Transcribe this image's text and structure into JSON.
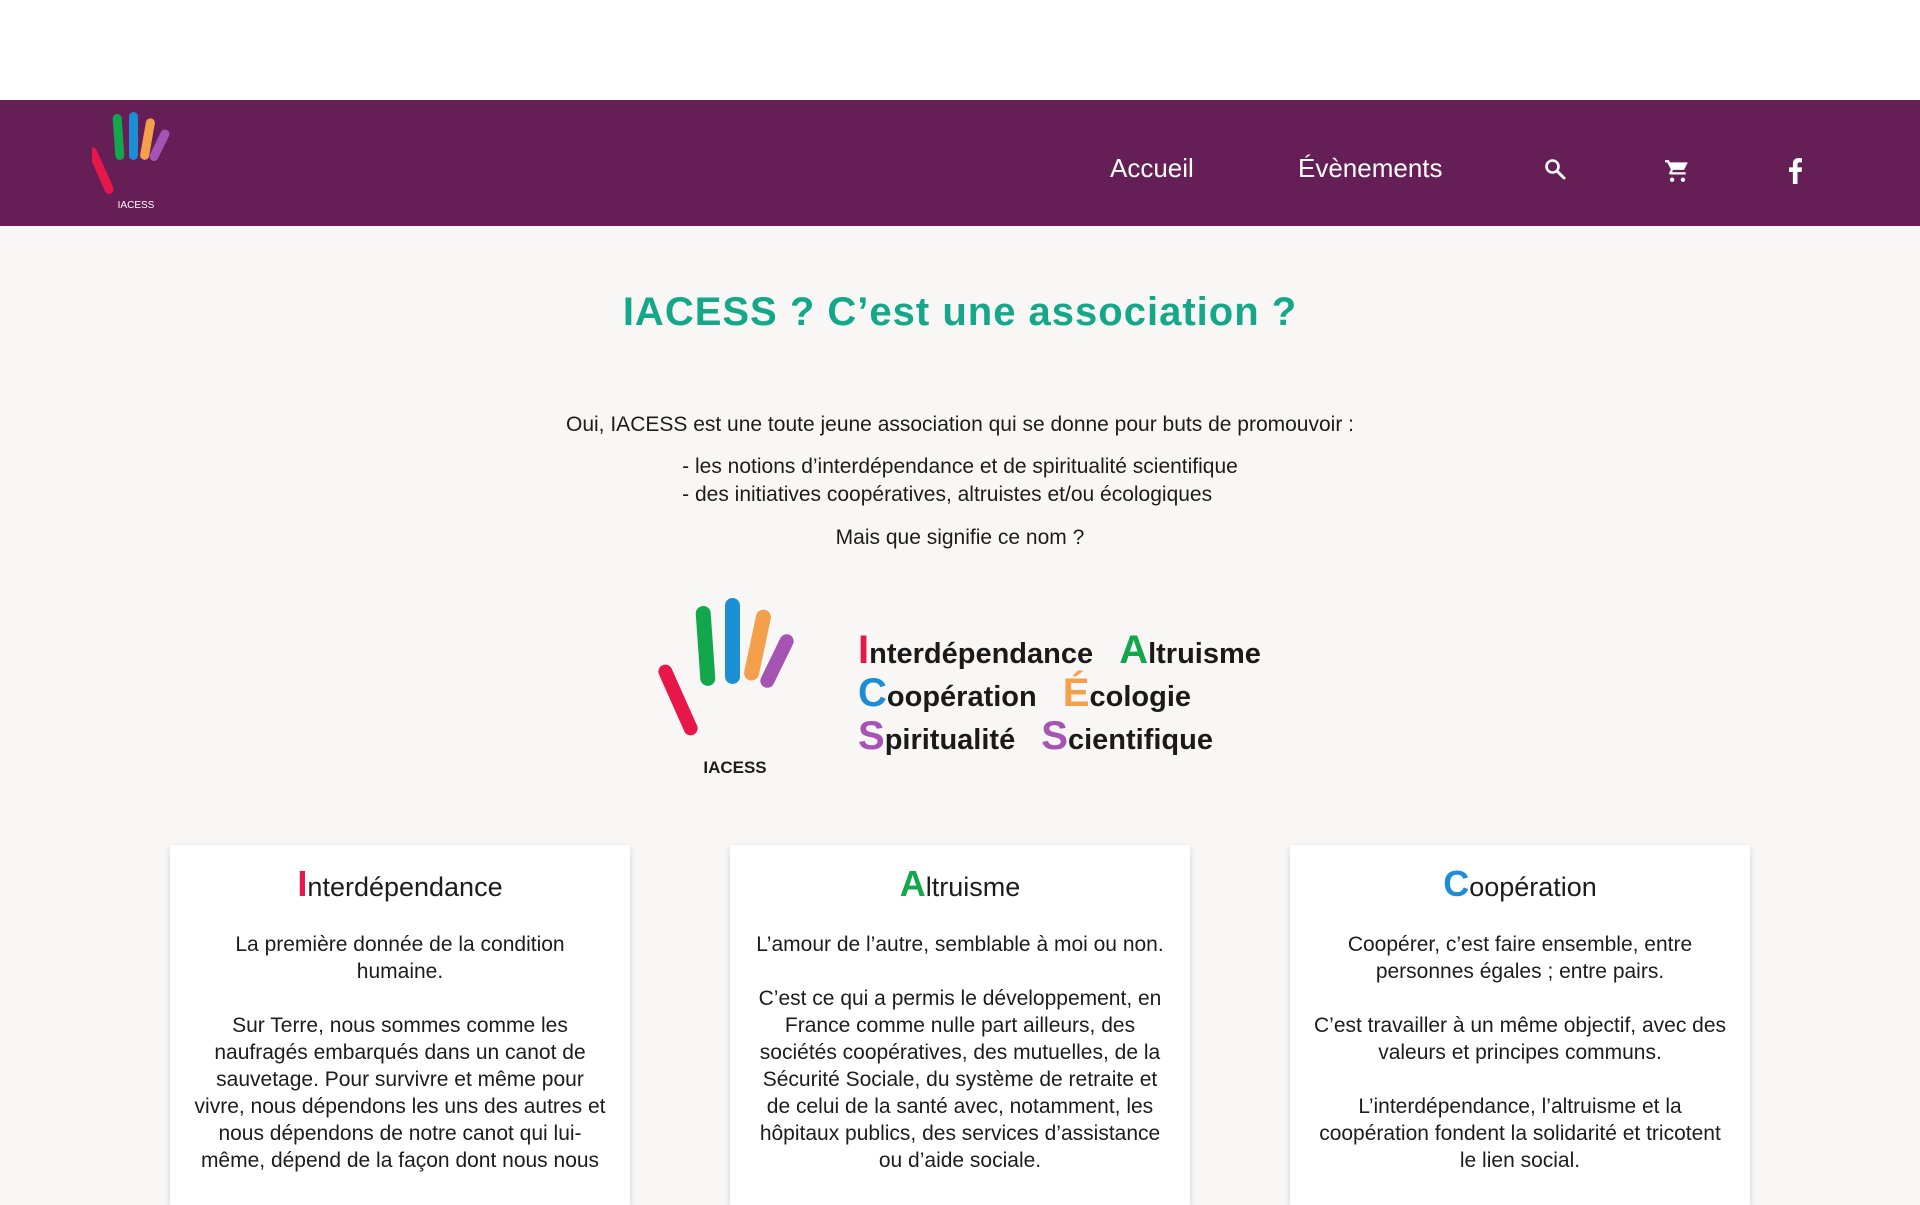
{
  "brand": {
    "logo_text": "IACESS",
    "colors": {
      "purple_header": "#661e57",
      "title_green": "#14a888",
      "red": "#e8174a",
      "green": "#12a74b",
      "blue": "#1c8ed4",
      "orange": "#f4a04a",
      "violet": "#a554b3"
    }
  },
  "nav": {
    "items": [
      {
        "label": "Accueil"
      },
      {
        "label": "Évènements"
      }
    ],
    "icons": [
      "search-icon",
      "cart-icon",
      "facebook-icon"
    ]
  },
  "main": {
    "title": "IACESS ? C’est une association ?",
    "intro": "Oui, IACESS est une toute jeune association qui se donne pour buts de promouvoir :",
    "list": [
      "- les notions d’interdépendance et de spiritualité scientifique",
      "- des initiatives coopératives, altruistes et/ou écologiques"
    ],
    "question": "Mais que signifie ce nom ?"
  },
  "acronym": {
    "rows": [
      [
        {
          "letter": "I",
          "rest": "nterdépendance",
          "color": "#e8174a"
        },
        {
          "letter": "A",
          "rest": "ltruisme",
          "color": "#12a74b"
        }
      ],
      [
        {
          "letter": "C",
          "rest": "oopération",
          "color": "#1c8ed4"
        },
        {
          "letter": "É",
          "rest": "cologie",
          "color": "#f4a04a"
        }
      ],
      [
        {
          "letter": "S",
          "rest": "piritualité",
          "color": "#a554b3"
        },
        {
          "letter": "S",
          "rest": "cientifique",
          "color": "#a554b3"
        }
      ]
    ],
    "logo_text": "IACESS"
  },
  "cards": [
    {
      "letter": "I",
      "rest": "nterdépendance",
      "color": "#e8174a",
      "p1": "La première donnée de la condition humaine.",
      "p2": "Sur Terre, nous sommes comme les naufragés embarqués dans un canot de sauvetage. Pour survivre et même pour vivre, nous dépendons les uns des autres et nous dépendons de notre canot qui lui-même, dépend de la façon dont nous nous"
    },
    {
      "letter": "A",
      "rest": "ltruisme",
      "color": "#12a74b",
      "p1": "L’amour de l’autre, semblable à moi ou non.",
      "p2": "C’est ce qui a permis le développement, en France comme nulle part ailleurs, des sociétés coopératives, des mutuelles, de la Sécurité Sociale, du système de retraite et de celui de la santé avec, notamment, les hôpitaux publics, des services d’assistance ou d’aide sociale."
    },
    {
      "letter": "C",
      "rest": "oopération",
      "color": "#1c8ed4",
      "p1": "Coopérer, c’est faire ensemble, entre personnes égales ; entre pairs.",
      "p2": "C’est travailler à un même objectif, avec des valeurs et principes communs.",
      "p3": "L’interdépendance, l’altruisme et la coopération fondent la solidarité et tricotent le lien social."
    }
  ]
}
